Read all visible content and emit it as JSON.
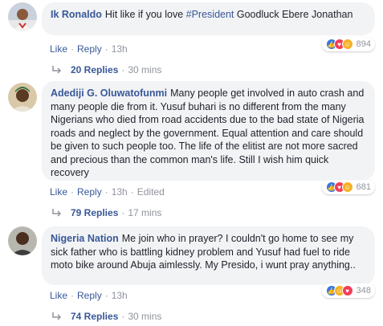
{
  "comments": [
    {
      "author": "Ik Ronaldo",
      "text_before": "Hit like if you love ",
      "hashtag": "#President",
      "text_after": " Goodluck Ebere Jonathan",
      "actions": {
        "like": "Like",
        "reply": "Reply",
        "time": "13h",
        "edited": ""
      },
      "reaction_count": "894",
      "reactions": [
        "like-icon",
        "love-icon",
        "haha-icon"
      ],
      "replies_label": "20 Replies",
      "replies_time": "30 mins"
    },
    {
      "author": "Adediji G. Oluwatofunmi",
      "text": "Many people get involved in auto crash and many people die from it. Yusuf buhari is no different from the many Nigerians who died from road accidents due to the bad state of Nigeria roads and neglect by the government. Equal attention and care should be given to such people too. The life of the elitist are not more sacred and precious than the common man's life. Still I wish him quick recovery",
      "actions": {
        "like": "Like",
        "reply": "Reply",
        "time": "13h",
        "edited": "Edited"
      },
      "reaction_count": "681",
      "reactions": [
        "like-icon",
        "love-icon",
        "haha-icon"
      ],
      "replies_label": "79 Replies",
      "replies_time": "17 mins"
    },
    {
      "author": "Nigeria Nation",
      "text": "Me join who in prayer? I couldn't go home to see my sick father who is battling kidney problem and Yusuf had fuel to ride moto bike around Abuja aimlessly. My Presido, i wunt pray anything..",
      "actions": {
        "like": "Like",
        "reply": "Reply",
        "time": "13h",
        "edited": ""
      },
      "reaction_count": "348",
      "reactions": [
        "like-icon",
        "haha-icon",
        "love-icon"
      ],
      "replies_label": "74 Replies",
      "replies_time": "30 mins"
    }
  ],
  "colors": {
    "link": "#385898",
    "bubble": "#f2f3f5",
    "meta": "#90949c",
    "like": "#3578e5",
    "love": "#f33e58",
    "haha": "#f7b125"
  }
}
